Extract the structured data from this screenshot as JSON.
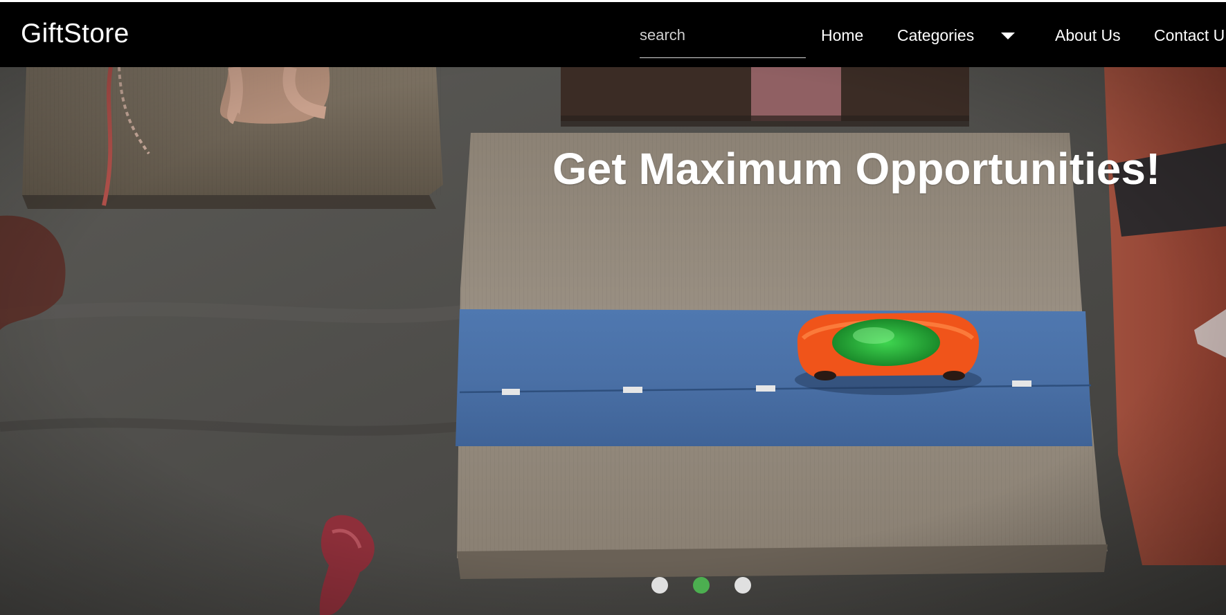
{
  "navbar": {
    "brand": "GiftStore",
    "search_placeholder": "search",
    "links": {
      "home": "Home",
      "categories": "Categories",
      "about": "About Us",
      "contact": "Contact U"
    }
  },
  "hero": {
    "title": "Get Maximum Opportunities!",
    "slides": {
      "count": 3,
      "active_index": 1
    }
  },
  "colors": {
    "navbar_bg": "#000000",
    "nav_text": "#ffffff",
    "dot_active": "#4caf50",
    "dot_inactive": "#e0e0e0"
  },
  "icons": {
    "dropdown": "caret-down-icon"
  }
}
